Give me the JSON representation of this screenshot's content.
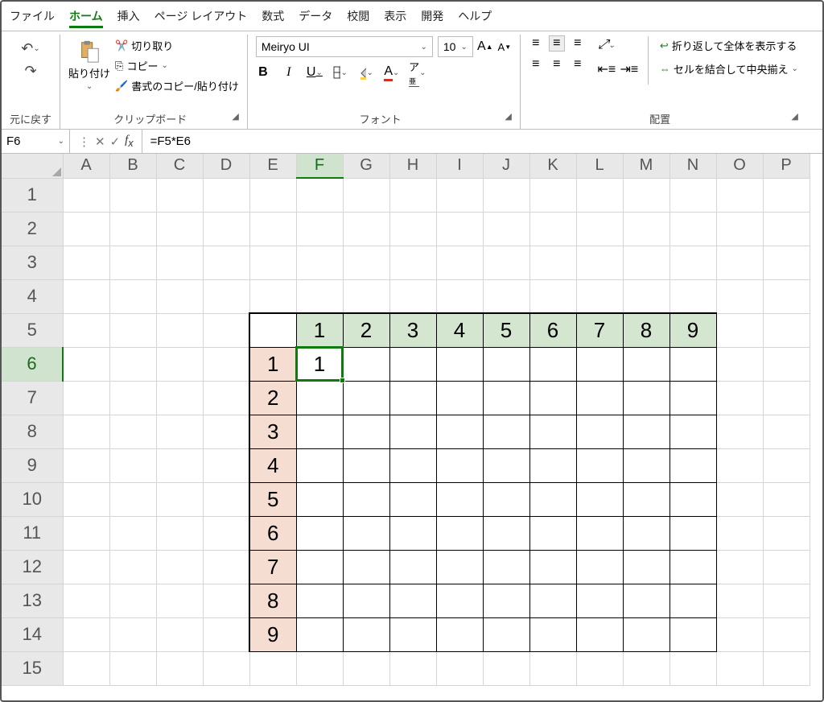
{
  "menu": {
    "items": [
      "ファイル",
      "ホーム",
      "挿入",
      "ページ レイアウト",
      "数式",
      "データ",
      "校閲",
      "表示",
      "開発",
      "ヘルプ"
    ],
    "active": "ホーム"
  },
  "ribbon": {
    "undo": {
      "label": "元に戻す"
    },
    "clipboard": {
      "paste": "貼り付け",
      "cut": "切り取り",
      "copy": "コピー",
      "formatp": "書式のコピー/貼り付け",
      "label": "クリップボード"
    },
    "font": {
      "name": "Meiryo UI",
      "size": "10",
      "label": "フォント"
    },
    "alignment": {
      "wrap": "折り返して全体を表示する",
      "merge": "セルを結合して中央揃え",
      "label": "配置"
    }
  },
  "formula": {
    "cell": "F6",
    "formula": "=F5*E6"
  },
  "sheet": {
    "columns": [
      "A",
      "B",
      "C",
      "D",
      "E",
      "F",
      "G",
      "H",
      "I",
      "J",
      "K",
      "L",
      "M",
      "N",
      "O",
      "P"
    ],
    "rows": [
      1,
      2,
      3,
      4,
      5,
      6,
      7,
      8,
      9,
      10,
      11,
      12,
      13,
      14,
      15
    ],
    "selected_col": "F",
    "selected_row": 6,
    "table": {
      "top_headers": [
        1,
        2,
        3,
        4,
        5,
        6,
        7,
        8,
        9
      ],
      "left_headers": [
        1,
        2,
        3,
        4,
        5,
        6,
        7,
        8,
        9
      ],
      "value_F6": "1"
    }
  }
}
